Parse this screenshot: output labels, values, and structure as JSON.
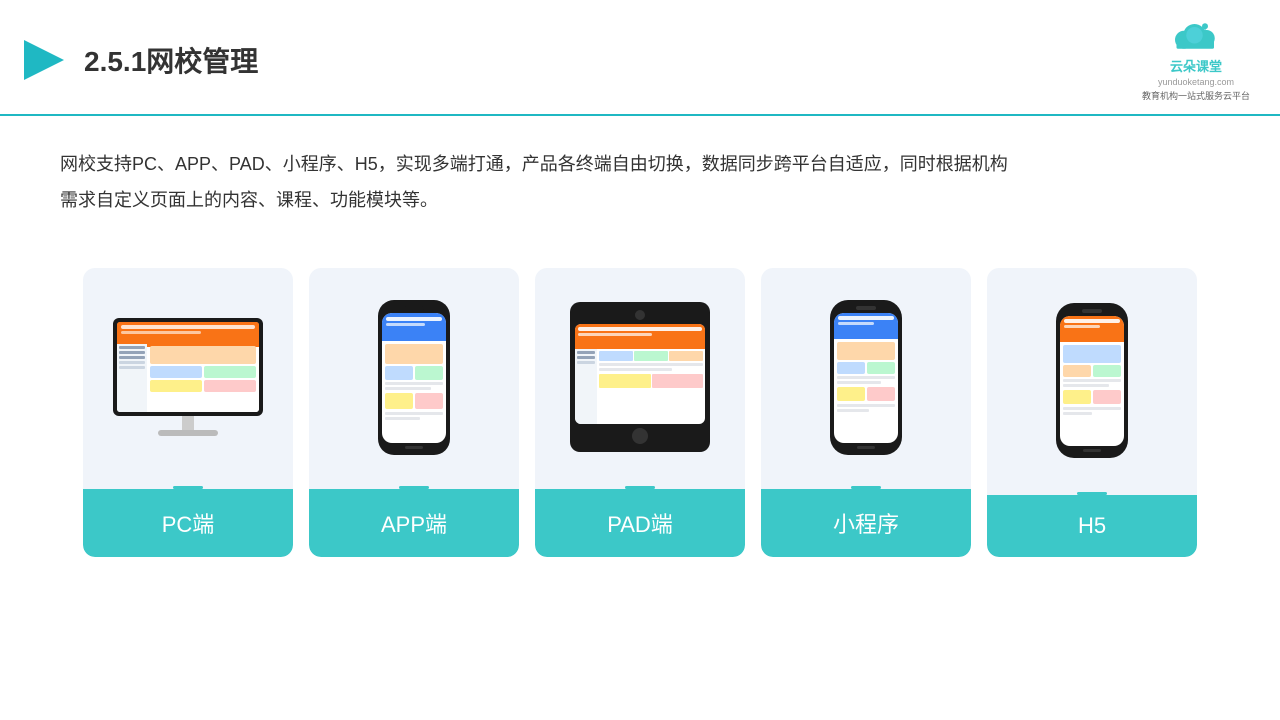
{
  "header": {
    "title": "2.5.1网校管理",
    "logo_name": "云朵课堂",
    "logo_url": "yunduoketang.com",
    "logo_tagline": "教育机构一站式服务云平台"
  },
  "description": {
    "text": "网校支持PC、APP、PAD、小程序、H5，实现多端打通，产品各终端自由切换，数据同步跨平台自适应，同时根据机构需求自定义页面上的内容、课程、功能模块等。"
  },
  "cards": [
    {
      "id": "pc",
      "label": "PC端"
    },
    {
      "id": "app",
      "label": "APP端"
    },
    {
      "id": "pad",
      "label": "PAD端"
    },
    {
      "id": "miniprogram",
      "label": "小程序"
    },
    {
      "id": "h5",
      "label": "H5"
    }
  ],
  "brand_color": "#3cc8c8",
  "accent_color": "#f97316"
}
